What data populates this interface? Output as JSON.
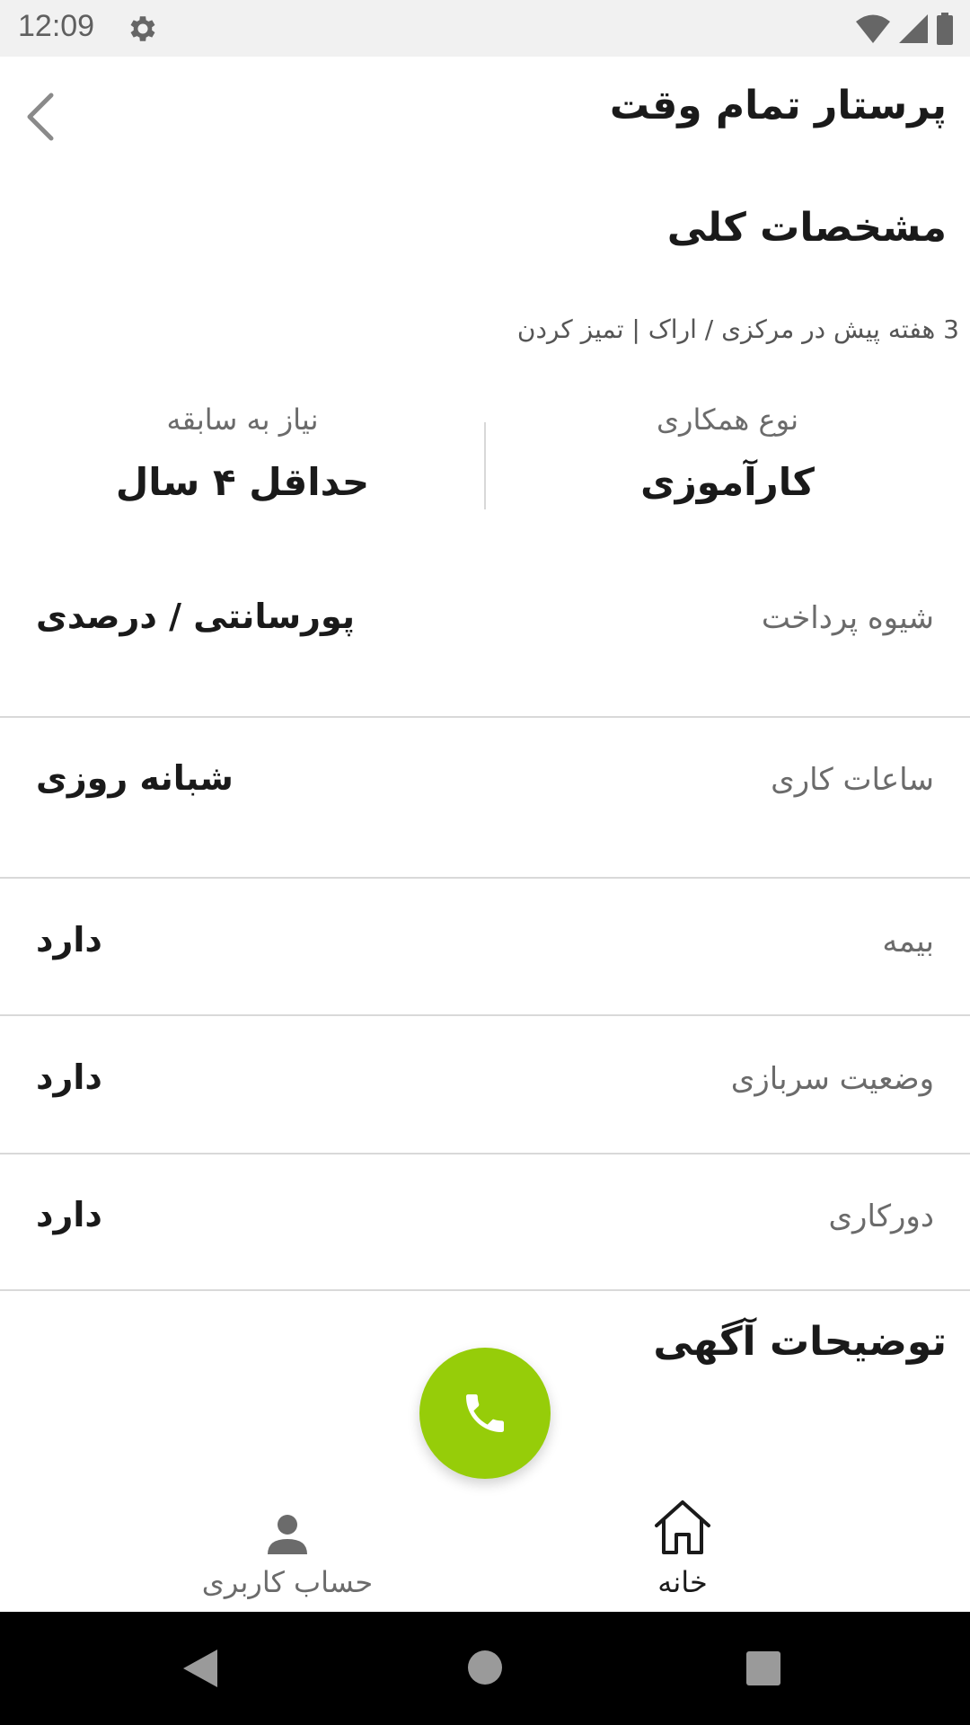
{
  "status_bar": {
    "time": "12:09"
  },
  "header": {
    "title": "پرستار تمام وقت"
  },
  "overview": {
    "heading": "مشخصات کلی",
    "meta": "3 هفته پیش در مرکزی / اراک | تمیز کردن",
    "cooperation_type": {
      "label": "نوع همکاری",
      "value": "کارآموزی"
    },
    "experience": {
      "label": "نیاز به سابقه",
      "value": "حداقل ۴ سال"
    }
  },
  "details": [
    {
      "label": "شیوه پرداخت",
      "value": "پورسانتی / درصدی"
    },
    {
      "label": "ساعات کاری",
      "value": "شبانه روزی"
    },
    {
      "label": "بیمه",
      "value": "دارد"
    },
    {
      "label": "وضعیت سربازی",
      "value": "دارد"
    },
    {
      "label": "دورکاری",
      "value": "دارد"
    }
  ],
  "description": {
    "heading": "توضیحات آگهی"
  },
  "bottom_nav": {
    "home": "خانه",
    "account": "حساب کاربری"
  },
  "colors": {
    "fab": "#96cd09",
    "status_bar": "#f1f1f1"
  },
  "icons": [
    "settings-icon",
    "wifi-icon",
    "signal-icon",
    "battery-icon",
    "back-chevron-icon",
    "phone-icon",
    "home-icon",
    "person-icon"
  ]
}
